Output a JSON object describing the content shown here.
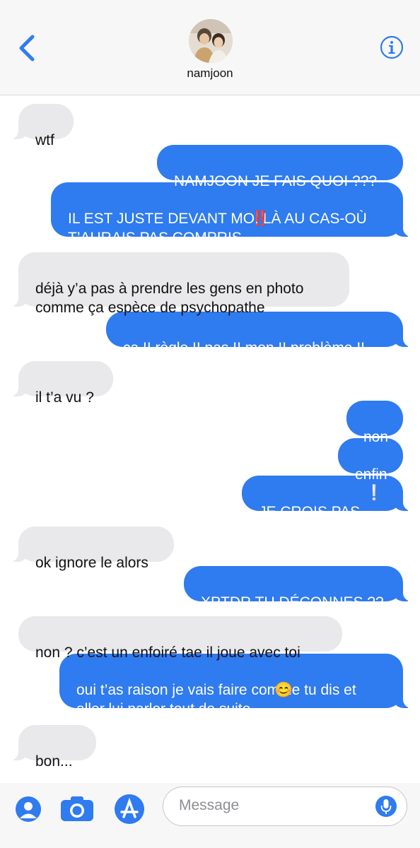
{
  "header": {
    "contact_name": "namjoon",
    "accent": "#2f7bf0"
  },
  "messages": [
    {
      "dir": "in",
      "text": "wtf"
    },
    {
      "dir": "out",
      "text": "NAMJOON JE FAIS QUOI ???"
    },
    {
      "dir": "out",
      "text": "IL EST JUSTE DEVANT MOI LÀ AU CAS-OÙ\nT’AURAIS PAS COMPRIS",
      "emoji": "‼️"
    },
    {
      "dir": "in",
      "text": "déjà y’a pas à prendre les gens en photo\ncomme ça espèce de psychopathe"
    },
    {
      "dir": "out",
      "text": "ça !! règle !! pas !! mon !! problème !!"
    },
    {
      "dir": "in",
      "text": "il t’a vu ?"
    },
    {
      "dir": "out",
      "text": "non"
    },
    {
      "dir": "out",
      "text": "enfin"
    },
    {
      "dir": "out",
      "text": "JE CROIS PAS",
      "emoji": "❕"
    },
    {
      "dir": "in",
      "text": "ok ignore le alors"
    },
    {
      "dir": "out",
      "text": "XPTDR TU DÉCONNES ??"
    },
    {
      "dir": "in",
      "text": "non ? c’est un enfoiré tae il joue avec toi"
    },
    {
      "dir": "out",
      "text": "oui t’as raison je vais faire comme tu dis et\naller lui parler tout de suite",
      "emoji": "😊"
    },
    {
      "dir": "in",
      "text": "bon..."
    }
  ],
  "composer": {
    "placeholder": "Message",
    "icons": [
      "contact-icon",
      "camera-icon",
      "app-store-icon",
      "mic-icon"
    ]
  }
}
